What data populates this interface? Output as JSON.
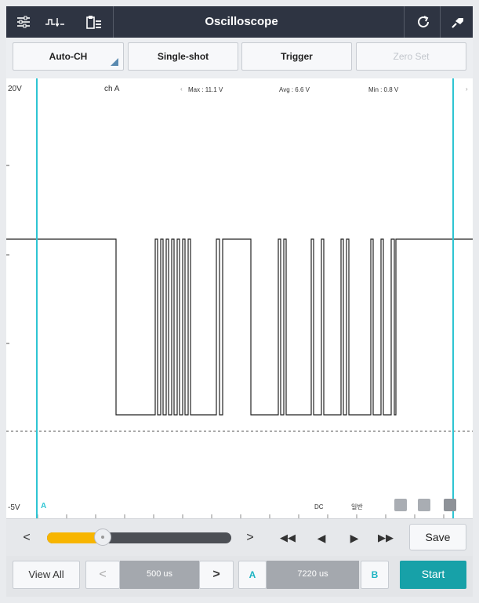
{
  "header": {
    "title": "Oscilloscope",
    "icons": [
      "settings-sliders-icon",
      "signal-probe-icon",
      "file-list-icon",
      "refresh-icon",
      "probe-pin-icon"
    ]
  },
  "modes": {
    "auto_ch": "Auto-CH",
    "single_shot": "Single-shot",
    "trigger": "Trigger",
    "zero_set": "Zero Set"
  },
  "scope": {
    "ymax_label": "20V",
    "ymin_label": "-5V",
    "channel": "ch A",
    "max": "Max : 11.1 V",
    "avg": "Avg : 6.6 V",
    "min": "Min : 0.8 V",
    "cursor_a": "A",
    "coupling": "DC",
    "mode": "일반",
    "colors": {
      "cursor": "#2ec5d3",
      "trace": "#222222"
    }
  },
  "navigation": {
    "slider_position": 0.3,
    "prev": "<",
    "next": ">",
    "save": "Save"
  },
  "bottom": {
    "view_all": "View All",
    "dec": "<",
    "timebase": "500 us",
    "inc": ">",
    "cursor_a": "A",
    "cursor_delta": "7220 us",
    "cursor_b": "B",
    "start": "Start"
  }
}
